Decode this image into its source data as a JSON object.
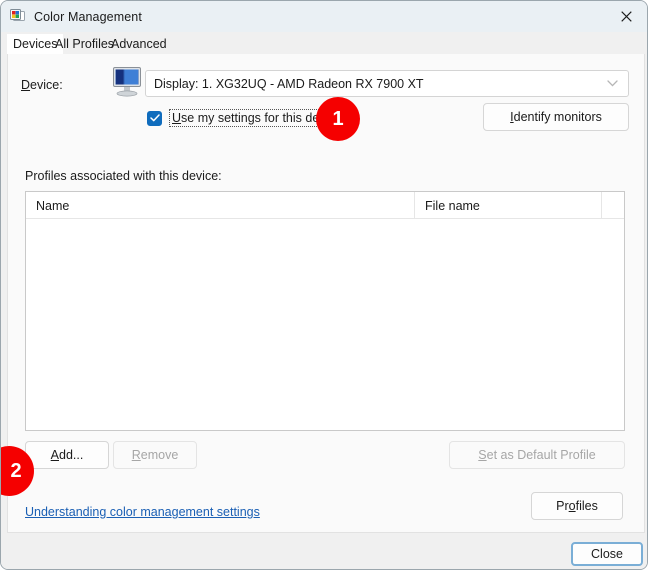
{
  "window": {
    "title": "Color Management",
    "icon": "color-management-icon",
    "close_icon": "close-icon"
  },
  "tabs": [
    {
      "label": "Devices",
      "active": true
    },
    {
      "label": "All Profiles",
      "active": false
    },
    {
      "label": "Advanced",
      "active": false
    }
  ],
  "device": {
    "label": "Device:",
    "label_accel": "D",
    "icon": "monitor-icon",
    "combo_value": "Display: 1. XG32UQ - AMD Radeon RX 7900 XT",
    "combo_chevron": "chevron-down-icon",
    "checkbox": {
      "label": "Use my settings for this device",
      "accel": "U",
      "checked": true,
      "check_icon": "checkmark-icon"
    },
    "identify_button": "Identify monitors",
    "identify_accel": "I"
  },
  "profiles": {
    "section_label": "Profiles associated with this device:",
    "columns": [
      "Name",
      "File name",
      ""
    ],
    "rows": [],
    "add_button": "Add...",
    "add_accel": "A",
    "remove_button": "Remove",
    "remove_accel": "R",
    "remove_disabled": true,
    "set_default_button": "Set as Default Profile",
    "set_default_accel": "S",
    "set_default_disabled": true
  },
  "footer": {
    "help_link": "Understanding color management settings",
    "profiles_button": "Profiles",
    "profiles_accel": "o",
    "close_button": "Close"
  },
  "badges": [
    {
      "number": "1"
    },
    {
      "number": "2"
    }
  ],
  "colors": {
    "badge_red": "#f50000",
    "accent_blue": "#0f6cbd",
    "link_blue": "#1a5fb4",
    "titlebar": "#eaf0f4",
    "panel": "#fafafa"
  }
}
